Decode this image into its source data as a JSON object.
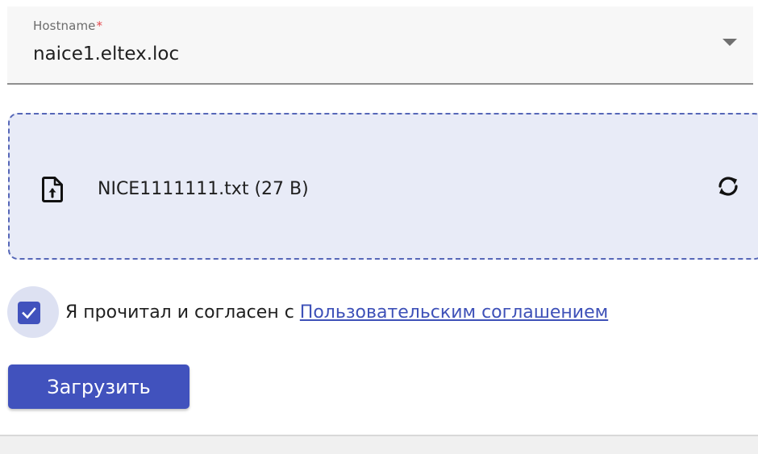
{
  "hostname": {
    "label": "Hostname",
    "required_mark": "*",
    "value": "naice1.eltex.loc"
  },
  "upload": {
    "file_name": "NICE1111111.txt (27 B)",
    "file_icon": "file-upload-icon",
    "replace_icon": "refresh-icon"
  },
  "agreement": {
    "checked": true,
    "text": "Я прочитал и согласен с",
    "link_text": "Пользовательским соглашением"
  },
  "actions": {
    "upload_label": "Загрузить"
  },
  "colors": {
    "primary": "#4152bd",
    "dropzone_bg": "#e8ebf7",
    "required": "#e5484d",
    "link": "#3e51b8"
  }
}
